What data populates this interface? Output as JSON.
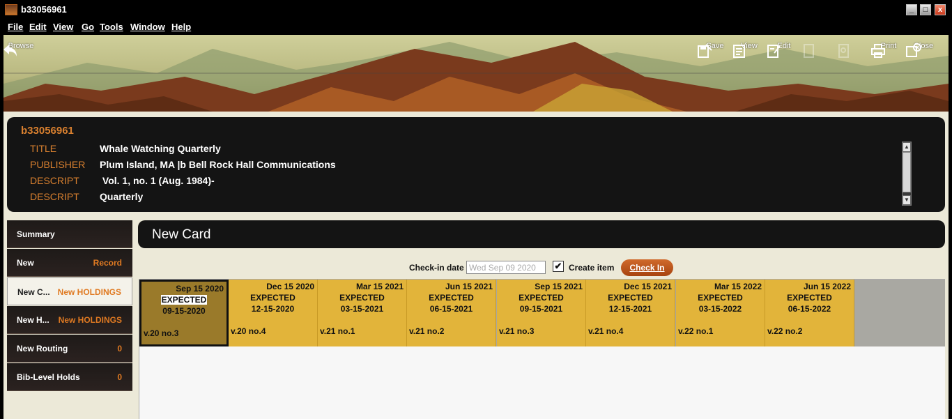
{
  "window": {
    "title": "b33056961",
    "minimize": "_",
    "maximize": "□",
    "close": "x"
  },
  "menu": [
    "File",
    "Edit",
    "View",
    "Go",
    "Tools",
    "Window",
    "Help"
  ],
  "toolbar": {
    "browse": "Browse",
    "save": "Save",
    "view": "View",
    "edit": "Edit",
    "print": "Print",
    "close": "Close"
  },
  "bib": {
    "id": "b33056961",
    "fields": [
      {
        "label": "TITLE",
        "value": "Whale Watching Quarterly"
      },
      {
        "label": "PUBLISHER",
        "value": "Plum Island, MA |b Bell Rock Hall Communications"
      },
      {
        "label": "DESCRIPT",
        "value": " Vol. 1, no. 1 (Aug. 1984)-"
      },
      {
        "label": "DESCRIPT",
        "value": "Quarterly"
      }
    ]
  },
  "sidebar": [
    {
      "label": "Summary",
      "value": ""
    },
    {
      "label": "New",
      "value": "Record"
    },
    {
      "label": "New C...",
      "value": "New HOLDINGS",
      "active": true
    },
    {
      "label": "New H...",
      "value": "New HOLDINGS"
    },
    {
      "label": "New Routing",
      "value": "0"
    },
    {
      "label": "Bib-Level Holds",
      "value": "0"
    }
  ],
  "card_header": {
    "title": "New Card"
  },
  "checkin": {
    "date_label": "Check-in date",
    "date_value": "Wed Sep 09 2020",
    "create_item_label": "Create item",
    "create_item_checked": true,
    "checkin_button": "Check In"
  },
  "cards": [
    {
      "date": "Sep 15 2020",
      "status": "EXPECTED",
      "code": "09-15-2020",
      "volume": "v.20 no.3",
      "selected": true
    },
    {
      "date": "Dec 15 2020",
      "status": "EXPECTED",
      "code": "12-15-2020",
      "volume": "v.20 no.4"
    },
    {
      "date": "Mar 15 2021",
      "status": "EXPECTED",
      "code": "03-15-2021",
      "volume": "v.21 no.1"
    },
    {
      "date": "Jun 15 2021",
      "status": "EXPECTED",
      "code": "06-15-2021",
      "volume": "v.21 no.2"
    },
    {
      "date": "Sep 15 2021",
      "status": "EXPECTED",
      "code": "09-15-2021",
      "volume": "v.21 no.3"
    },
    {
      "date": "Dec 15 2021",
      "status": "EXPECTED",
      "code": "12-15-2021",
      "volume": "v.21 no.4"
    },
    {
      "date": "Mar 15 2022",
      "status": "EXPECTED",
      "code": "03-15-2022",
      "volume": "v.22 no.1"
    },
    {
      "date": "Jun 15 2022",
      "status": "EXPECTED",
      "code": "06-15-2022",
      "volume": "v.22 no.2"
    }
  ],
  "colors": {
    "accent": "#d9802f",
    "card": "#e2b43a",
    "card_selected": "#9a7a2a",
    "panel": "#141414"
  }
}
